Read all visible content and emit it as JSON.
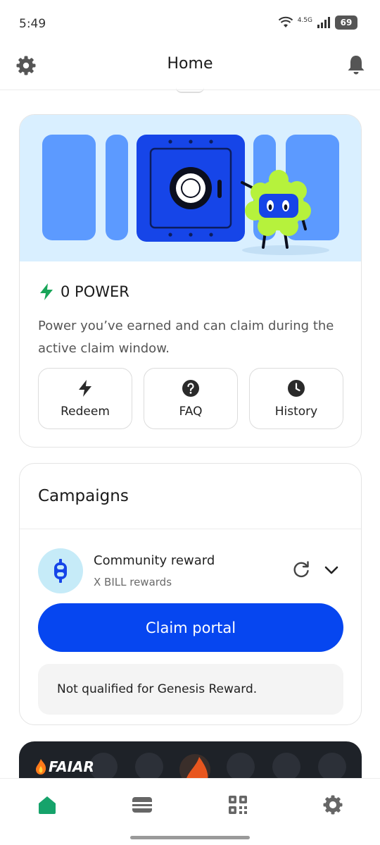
{
  "status_bar": {
    "time": "5:49",
    "network": "4.5G",
    "battery": "69"
  },
  "header": {
    "title": "Home",
    "settings_icon": "gear-icon",
    "notifications_icon": "bell-icon"
  },
  "power_card": {
    "value": "0 POWER",
    "description": "Power you’ve earned and can claim during the active claim window.",
    "actions": [
      {
        "label": "Redeem",
        "icon": "lightning-icon"
      },
      {
        "label": "FAQ",
        "icon": "question-icon"
      },
      {
        "label": "History",
        "icon": "clock-icon"
      }
    ]
  },
  "campaigns": {
    "title": "Campaigns",
    "item": {
      "name": "Community reward",
      "subtitle": "X BILL rewards",
      "claim_label": "Claim portal",
      "notice": "Not qualified for Genesis Reward."
    }
  },
  "faiar_banner": {
    "logo_text": "FAIAR"
  },
  "bottom_nav": {
    "items": [
      "home-icon",
      "wallet-icon",
      "qr-scan-icon",
      "settings-icon"
    ],
    "active": "home-icon"
  },
  "colors": {
    "accent_blue": "#0646f0",
    "active_green": "#16a36b",
    "power_green": "#18a558",
    "banner_bg": "#d9efff"
  }
}
